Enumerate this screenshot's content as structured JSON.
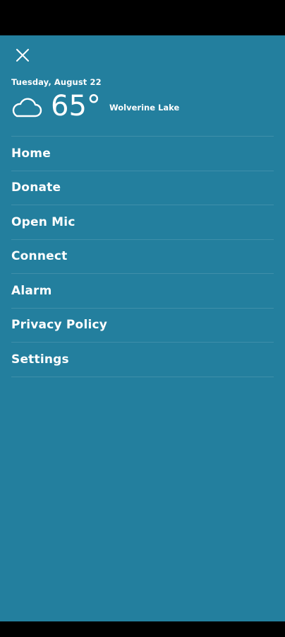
{
  "drawer": {
    "date": "Tuesday, August 22",
    "weather": {
      "icon": "cloud-icon",
      "temperature": "65°",
      "location": "Wolverine Lake"
    },
    "menu": [
      {
        "label": "Home"
      },
      {
        "label": "Donate"
      },
      {
        "label": "Open Mic"
      },
      {
        "label": "Connect"
      },
      {
        "label": "Alarm"
      },
      {
        "label": "Privacy Policy"
      },
      {
        "label": "Settings"
      }
    ]
  },
  "colors": {
    "drawer_background": "#237f9e",
    "text": "#ffffff",
    "system_bars": "#000000"
  }
}
